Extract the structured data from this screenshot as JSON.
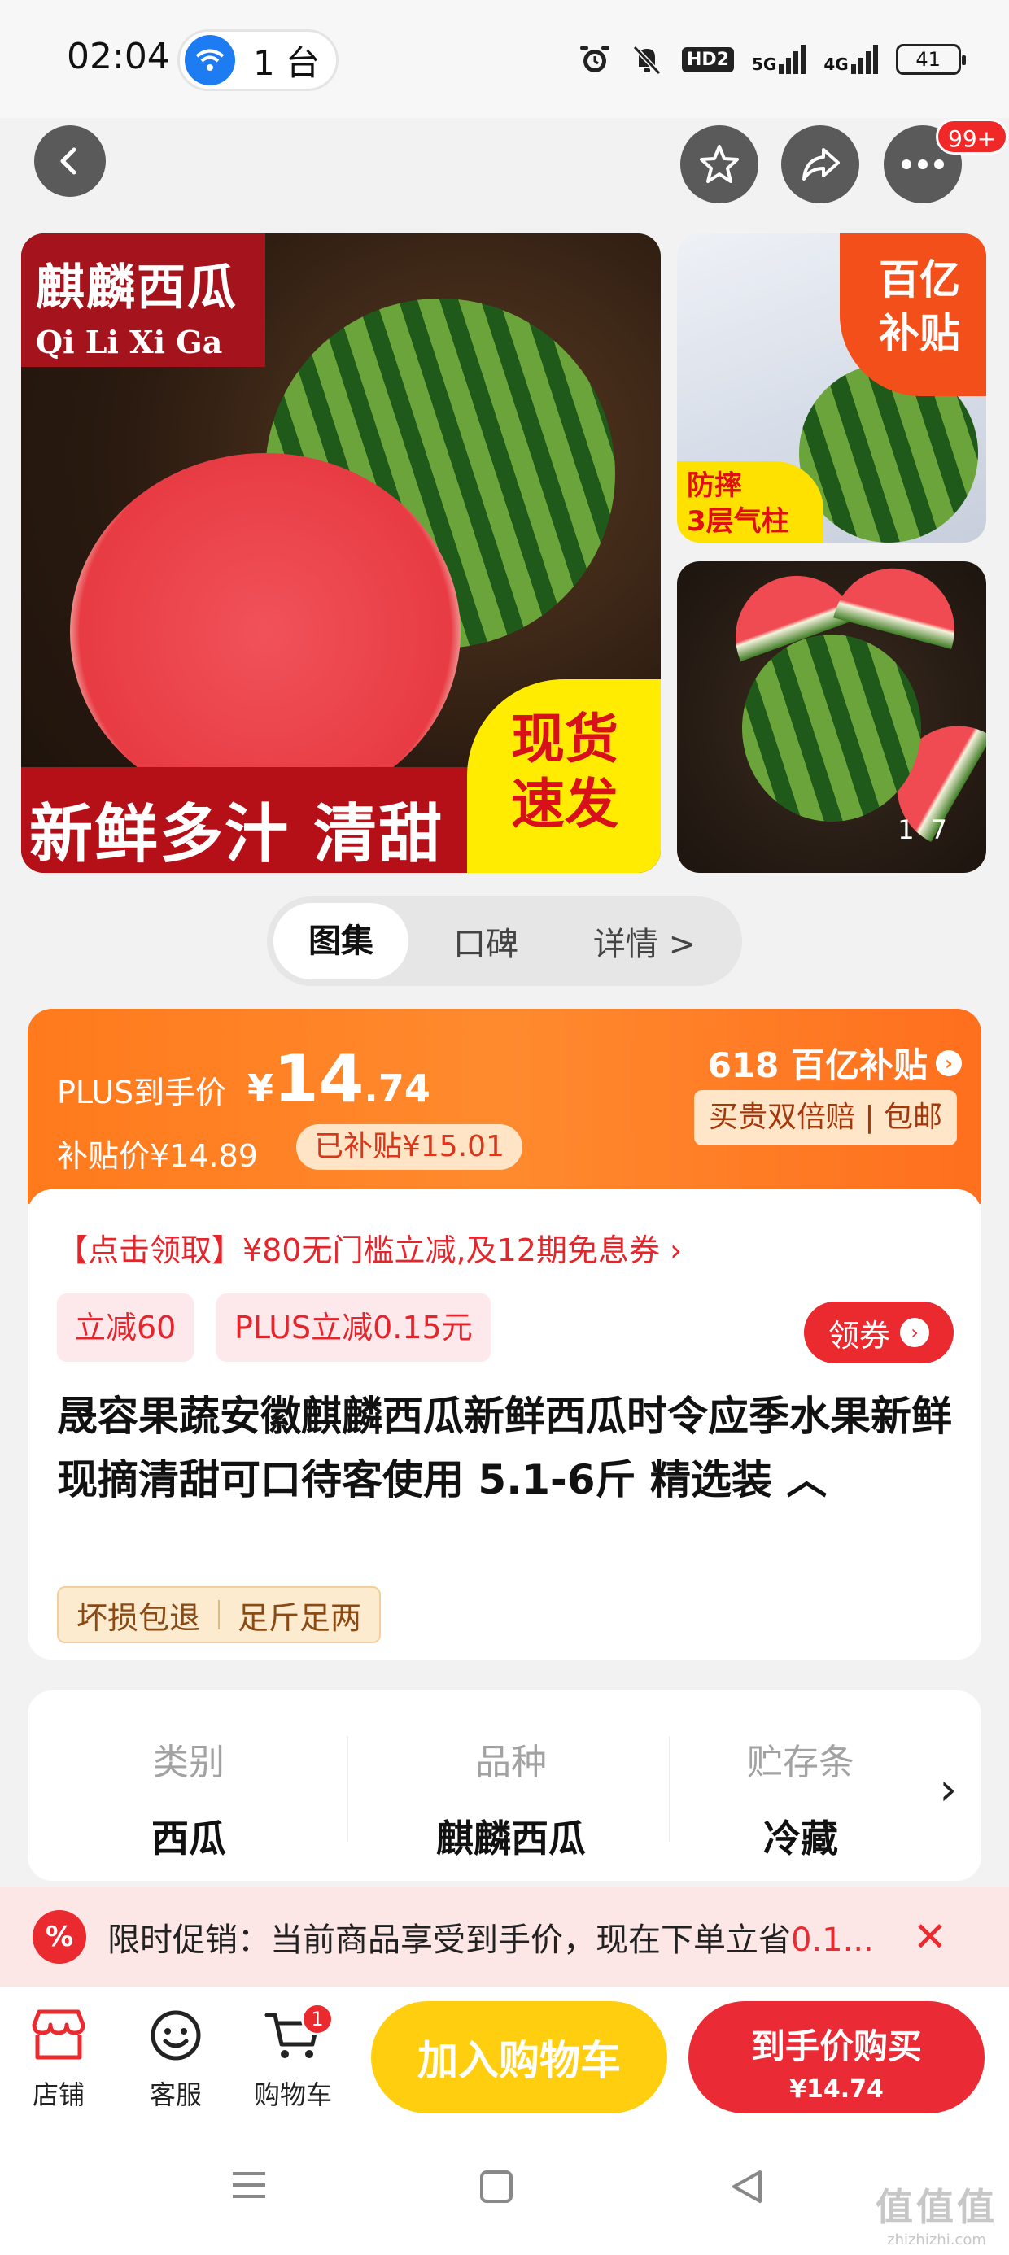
{
  "status_bar": {
    "time": "02:04",
    "hotspot_count": "1 台",
    "network_1": "5G",
    "network_2": "4G",
    "hd_badge": "HD2",
    "battery": "41"
  },
  "header": {
    "more_badge": "99+"
  },
  "gallery": {
    "main_title_cn": "麒麟西瓜",
    "main_title_pinyin": "Qi Li Xi Ga",
    "main_banner": "新鲜多汁 清甜",
    "main_badge_line1": "现货",
    "main_badge_line2": "速发",
    "side1_badge_line1": "百亿",
    "side1_badge_line2": "补贴",
    "side1_tag_line1": "防摔",
    "side1_tag_line2": "3层气柱",
    "counter_current": "1",
    "counter_total": "7"
  },
  "tabs": [
    "图集",
    "口碑",
    "详情 >"
  ],
  "price": {
    "plus_label": "PLUS到手价",
    "plus_currency": "¥",
    "plus_integer": "14",
    "plus_decimal": ".74",
    "subsidy_price": "补贴价¥14.89",
    "subsidy_done": "已补贴¥15.01",
    "promo_618": "618 百亿补贴",
    "guarantee": "买贵双倍赔 | 包邮"
  },
  "coupons": {
    "claim_line": "【点击领取】¥80无门槛立减,及12期免息券 ›",
    "tag1": "立减60",
    "tag2": "PLUS立减0.15元",
    "button": "领券"
  },
  "product": {
    "title": "晟容果蔬安徽麒麟西瓜新鲜西瓜时令应季水果新鲜现摘清甜可口待客使用 5.1-6斤 精选装 ︿",
    "service_tag1": "坏损包退",
    "service_tag2": "足斤足两"
  },
  "specs": [
    {
      "key": "类别",
      "value": "西瓜"
    },
    {
      "key": "品种",
      "value": "麒麟西瓜"
    },
    {
      "key": "贮存条",
      "value": "冷藏"
    }
  ],
  "promo_banner": {
    "icon": "%",
    "text": "限时促销：当前商品享受到手价，现在下单立省",
    "highlight": "0.1..."
  },
  "bottom_bar": {
    "shop": "店铺",
    "service": "客服",
    "cart": "购物车",
    "cart_badge": "1",
    "add_to_cart": "加入购物车",
    "buy_line1": "到手价购买",
    "buy_line2": "¥14.74"
  },
  "watermark": {
    "main": "值值值",
    "url": "zhizhizhi.com"
  },
  "colors": {
    "accent_red": "#ea2a2f",
    "accent_orange": "#ff7a1c",
    "cart_yellow": "#ffcf0f"
  }
}
